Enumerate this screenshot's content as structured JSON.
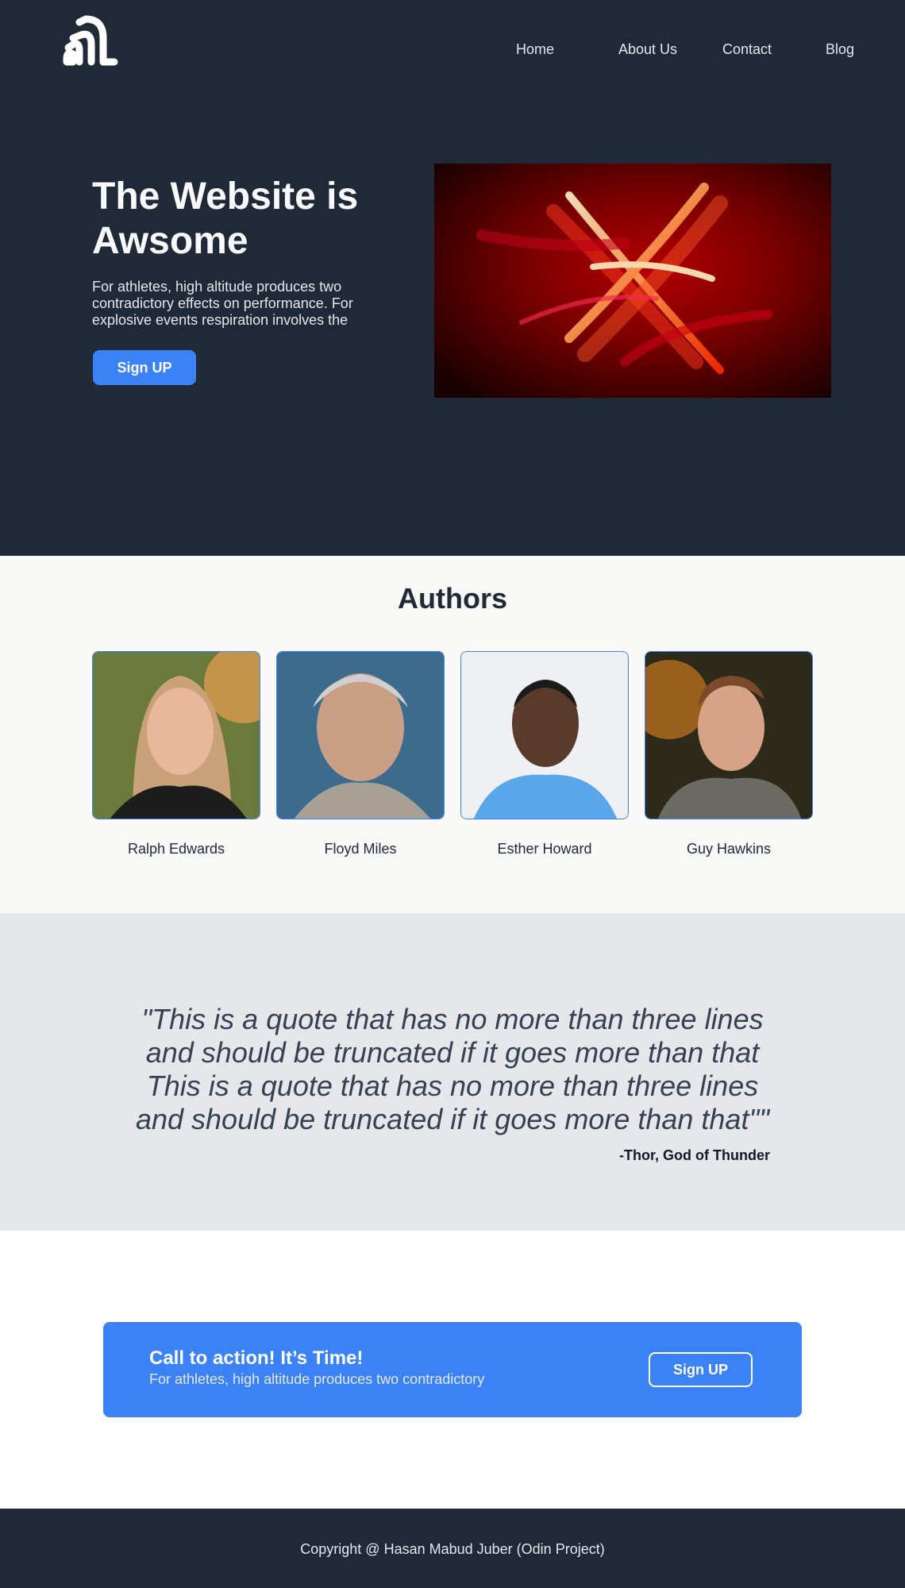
{
  "header": {
    "logo_icon": "stacked-arches-logo-icon",
    "nav": [
      {
        "label": "Home"
      },
      {
        "label": "About Us"
      },
      {
        "label": "Contact"
      },
      {
        "label": "Blog"
      }
    ]
  },
  "hero": {
    "title": "The Website is Awsome",
    "text": "For athletes, high altitude produces two contradictory effects on performance. For explosive events respiration involves the",
    "button_label": "Sign UP",
    "image_icon": "red-light-streak-image"
  },
  "authors": {
    "title": "Authors",
    "items": [
      {
        "name": "Ralph Edwards",
        "photo": "portrait-woman-blonde"
      },
      {
        "name": "Floyd Miles",
        "photo": "portrait-elderly-man"
      },
      {
        "name": "Esther Howard",
        "photo": "portrait-man-blue-shirt"
      },
      {
        "name": "Guy Hawkins",
        "photo": "portrait-young-man-blazer"
      }
    ]
  },
  "quote": {
    "text": "\"This is a quote that has no more than three lines and should be truncated if it goes more than that This is a quote that has no more than three lines and should be truncated if it goes more than that\"\"",
    "author": "-Thor, God of Thunder"
  },
  "cta": {
    "title": "Call to action! It’s Time!",
    "text": "For athletes, high altitude produces two contradictory",
    "button_label": "Sign UP"
  },
  "footer": {
    "text": "Copyright @ Hasan Mabud Juber (Odin Project)"
  },
  "colors": {
    "dark": "#1f2937",
    "accent": "#3b82f6",
    "authors_bg": "#f9f9f7",
    "quote_bg": "#e5e7eb"
  }
}
